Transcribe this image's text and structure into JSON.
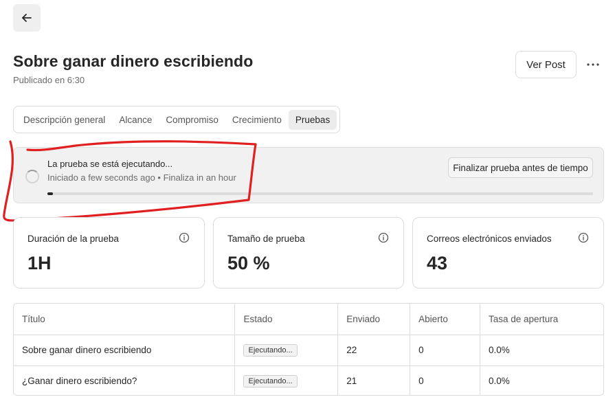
{
  "header": {
    "back_icon": "arrow-left-icon",
    "title": "Sobre ganar dinero escribiendo",
    "subtitle": "Publicado en 6:30",
    "ver_post_label": "Ver Post",
    "more_icon": "ellipsis-icon"
  },
  "tabs": [
    {
      "label": "Descripción general",
      "active": false
    },
    {
      "label": "Alcance",
      "active": false
    },
    {
      "label": "Compromiso",
      "active": false
    },
    {
      "label": "Crecimiento",
      "active": false
    },
    {
      "label": "Pruebas",
      "active": true
    }
  ],
  "run_status": {
    "title": "La prueba se está ejecutando...",
    "meta": "Iniciado a few seconds ago • Finaliza in an hour",
    "progress_percent": 1,
    "end_button_label": "Finalizar prueba antes de tiempo",
    "spinner_icon": "spinner-icon"
  },
  "stats": [
    {
      "label": "Duración de la prueba",
      "value": "1H",
      "icon": "info-icon"
    },
    {
      "label": "Tamaño de prueba",
      "value": "50 %",
      "icon": "info-icon"
    },
    {
      "label": "Correos electrónicos enviados",
      "value": "43",
      "icon": "info-icon"
    }
  ],
  "table": {
    "headers": [
      "Título",
      "Estado",
      "Enviado",
      "Abierto",
      "Tasa de apertura"
    ],
    "rows": [
      [
        "Sobre ganar dinero escribiendo",
        "Ejecutando...",
        "22",
        "0",
        "0.0%"
      ],
      [
        "¿Ganar dinero escribiendo?",
        "Ejecutando...",
        "21",
        "0",
        "0.0%"
      ]
    ]
  },
  "colors": {
    "annotation": "#e02020",
    "progress_fill": "#262626",
    "banner_bg": "#f1f1f1"
  }
}
